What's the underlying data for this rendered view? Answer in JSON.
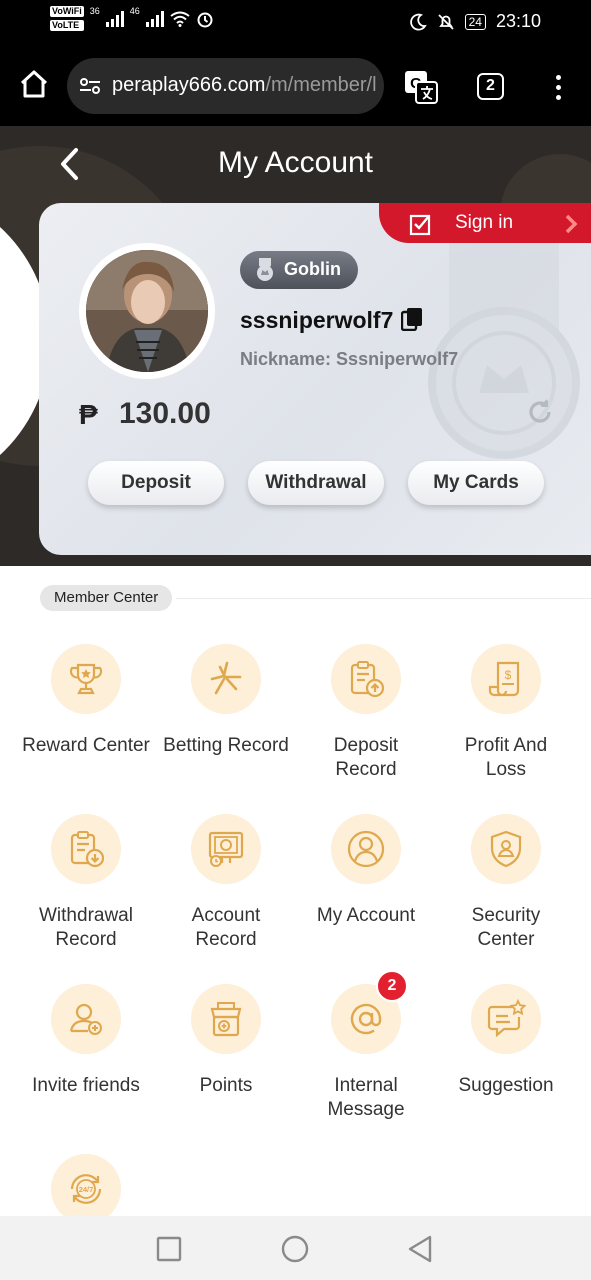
{
  "status_bar": {
    "volte_1": "VoWiFi",
    "volte_2": "VoLTE",
    "net_1": "36",
    "net_2": "46",
    "battery": "24",
    "time": "23:10"
  },
  "browser": {
    "url_domain": "peraplay666.com",
    "url_path": "/m/member/l",
    "tab_count": "2"
  },
  "header": {
    "title": "My Account"
  },
  "account": {
    "sign_in": "Sign in",
    "level": "Goblin",
    "username": "sssniperwolf7",
    "nickname_label": "Nickname: ",
    "nickname": "Sssniperwolf7",
    "currency": "₱",
    "balance": "130.00",
    "buttons": {
      "deposit": "Deposit",
      "withdrawal": "Withdrawal",
      "my_cards": "My Cards"
    }
  },
  "member_center": {
    "label": "Member Center",
    "items": [
      {
        "label": "Reward Center",
        "icon": "trophy-icon"
      },
      {
        "label": "Betting Record",
        "icon": "betting-record-icon"
      },
      {
        "label": "Deposit\nRecord",
        "icon": "deposit-record-icon"
      },
      {
        "label": "Profit And\nLoss",
        "icon": "profit-loss-icon"
      },
      {
        "label": "Withdrawal\nRecord",
        "icon": "withdrawal-record-icon"
      },
      {
        "label": "Account\nRecord",
        "icon": "account-record-icon"
      },
      {
        "label": "My Account",
        "icon": "user-icon"
      },
      {
        "label": "Security\nCenter",
        "icon": "shield-user-icon"
      },
      {
        "label": "Invite friends",
        "icon": "invite-friends-icon"
      },
      {
        "label": "Points",
        "icon": "points-icon"
      },
      {
        "label": "Internal\nMessage",
        "icon": "at-sign-icon",
        "badge": "2"
      },
      {
        "label": "Suggestion",
        "icon": "suggestion-icon"
      },
      {
        "label": "",
        "icon": "support-24-7-icon"
      }
    ]
  },
  "colors": {
    "accent_red": "#d3182c",
    "icon_gold": "#e0a84e",
    "icon_bg": "#fdefd8",
    "header_bg": "#2e2a28"
  }
}
